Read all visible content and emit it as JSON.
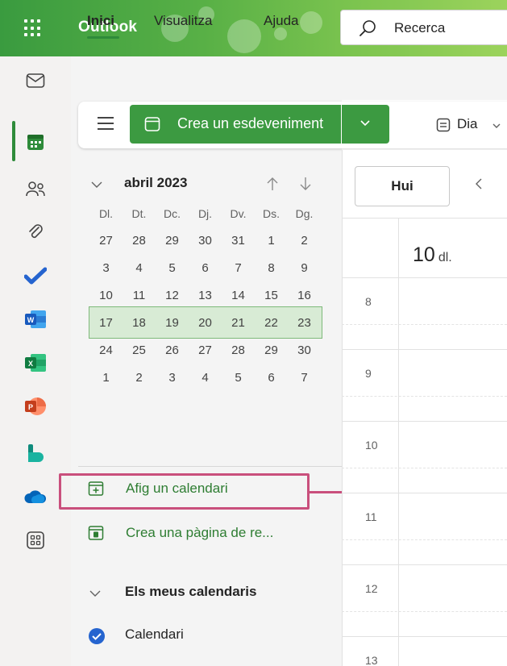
{
  "app": {
    "name": "Outlook"
  },
  "search": {
    "placeholder": "Recerca"
  },
  "ribbon": {
    "tabs": [
      {
        "label": "Inici",
        "active": true
      },
      {
        "label": "Visualitza",
        "active": false
      },
      {
        "label": "Ajuda",
        "active": false
      }
    ],
    "new_event_label": "Crea un esdeveniment",
    "view_label": "Dia"
  },
  "rail": {
    "items": [
      {
        "icon": "mail-icon"
      },
      {
        "icon": "calendar-icon",
        "active": true
      },
      {
        "icon": "people-icon"
      },
      {
        "icon": "attach-icon"
      },
      {
        "icon": "todo-icon"
      },
      {
        "icon": "word-icon"
      },
      {
        "icon": "excel-icon"
      },
      {
        "icon": "powerpoint-icon"
      },
      {
        "icon": "bookings-icon"
      },
      {
        "icon": "onedrive-icon"
      },
      {
        "icon": "more-apps-icon"
      }
    ]
  },
  "mini_calendar": {
    "title": "abril 2023",
    "weekdays": [
      "Dl.",
      "Dt.",
      "Dc.",
      "Dj.",
      "Dv.",
      "Ds.",
      "Dg."
    ],
    "weeks": [
      [
        "27",
        "28",
        "29",
        "30",
        "31",
        "1",
        "2"
      ],
      [
        "3",
        "4",
        "5",
        "6",
        "7",
        "8",
        "9"
      ],
      [
        "10",
        "11",
        "12",
        "13",
        "14",
        "15",
        "16"
      ],
      [
        "17",
        "18",
        "19",
        "20",
        "21",
        "22",
        "23"
      ],
      [
        "24",
        "25",
        "26",
        "27",
        "28",
        "29",
        "30"
      ],
      [
        "1",
        "2",
        "3",
        "4",
        "5",
        "6",
        "7"
      ]
    ],
    "selected_week_index": 2
  },
  "pane": {
    "add_calendar": "Afig un calendari",
    "create_booking": "Crea una pàgina de re...",
    "my_calendars": "Els meus calendaris",
    "calendar_item": "Calendari"
  },
  "day_view": {
    "today_label": "Hui",
    "day_number": "10",
    "day_name": "dl.",
    "hours": [
      "8",
      "9",
      "10",
      "11",
      "12",
      "13"
    ]
  },
  "colors": {
    "accent": "#3c9a41",
    "highlight": "#c94f7c",
    "selected_week": "#d8ebd5"
  }
}
